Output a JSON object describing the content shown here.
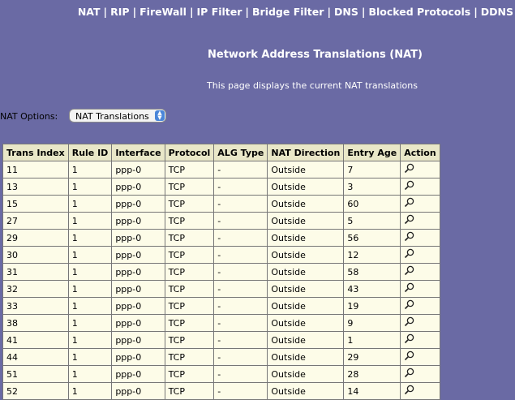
{
  "nav": [
    "NAT",
    "RIP",
    "FireWall",
    "IP Filter",
    "Bridge Filter",
    "DNS",
    "Blocked Protocols",
    "DDNS"
  ],
  "page": {
    "title": "Network Address Translations (NAT)",
    "description": "This page displays the current NAT translations"
  },
  "options": {
    "label": "NAT Options:",
    "selected": "NAT Translations"
  },
  "table": {
    "headers": [
      "Trans Index",
      "Rule ID",
      "Interface",
      "Protocol",
      "ALG Type",
      "NAT Direction",
      "Entry Age",
      "Action"
    ],
    "rows": [
      [
        "11",
        "1",
        "ppp-0",
        "TCP",
        "-",
        "Outside",
        "7"
      ],
      [
        "13",
        "1",
        "ppp-0",
        "TCP",
        "-",
        "Outside",
        "3"
      ],
      [
        "15",
        "1",
        "ppp-0",
        "TCP",
        "-",
        "Outside",
        "60"
      ],
      [
        "27",
        "1",
        "ppp-0",
        "TCP",
        "-",
        "Outside",
        "5"
      ],
      [
        "29",
        "1",
        "ppp-0",
        "TCP",
        "-",
        "Outside",
        "56"
      ],
      [
        "30",
        "1",
        "ppp-0",
        "TCP",
        "-",
        "Outside",
        "12"
      ],
      [
        "31",
        "1",
        "ppp-0",
        "TCP",
        "-",
        "Outside",
        "58"
      ],
      [
        "32",
        "1",
        "ppp-0",
        "TCP",
        "-",
        "Outside",
        "43"
      ],
      [
        "33",
        "1",
        "ppp-0",
        "TCP",
        "-",
        "Outside",
        "19"
      ],
      [
        "38",
        "1",
        "ppp-0",
        "TCP",
        "-",
        "Outside",
        "9"
      ],
      [
        "41",
        "1",
        "ppp-0",
        "TCP",
        "-",
        "Outside",
        "1"
      ],
      [
        "44",
        "1",
        "ppp-0",
        "TCP",
        "-",
        "Outside",
        "29"
      ],
      [
        "51",
        "1",
        "ppp-0",
        "TCP",
        "-",
        "Outside",
        "28"
      ],
      [
        "52",
        "1",
        "ppp-0",
        "TCP",
        "-",
        "Outside",
        "14"
      ]
    ],
    "action_icon": "magnifier-icon"
  },
  "colors": {
    "background": "#6a6aa4",
    "table_background": "#fdfce8",
    "table_header": "#e9e7c8"
  }
}
